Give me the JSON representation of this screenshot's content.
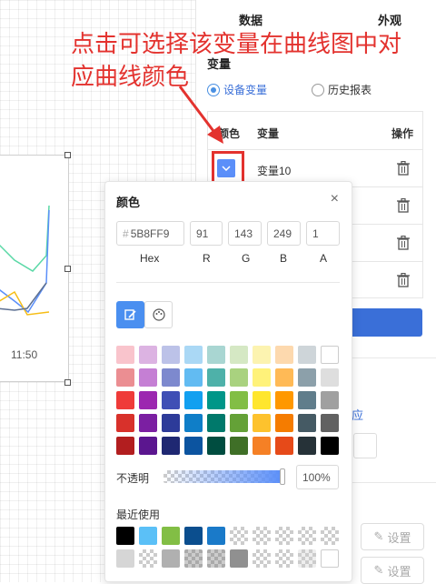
{
  "annotation": {
    "text": "点击可选择该变量在曲线图中对应曲线颜色",
    "color": "#e3322e"
  },
  "canvas": {
    "tick_label": "11:50"
  },
  "panel": {
    "tabs": [
      "数据",
      "外观"
    ],
    "section_title": "变量",
    "radio": {
      "options": [
        "设备变量",
        "历史报表"
      ],
      "selected": "设备变量"
    },
    "table": {
      "headers": {
        "color": "颜色",
        "variable": "变量",
        "action": "操作"
      },
      "rows": [
        {
          "name": "变量10",
          "color": "#5B8FF9"
        }
      ]
    },
    "link_partial": "应",
    "set_buttons": [
      "设置",
      "设置"
    ]
  },
  "picker": {
    "title": "颜色",
    "hex_value": "5B8FF9",
    "hex_prefix": "#",
    "r": "91",
    "g": "143",
    "b": "249",
    "a": "1",
    "labels": {
      "hex": "Hex",
      "r": "R",
      "g": "G",
      "b": "B",
      "a": "A"
    },
    "modes": [
      "palette-edit-icon",
      "palette-icon"
    ],
    "active_mode": "palette-edit-icon",
    "palette": [
      [
        "#f9c4cc",
        "#dcb3e2",
        "#bcc2e8",
        "#aad8f5",
        "#a9d6d2",
        "#d5e8c4",
        "#fcf3b0",
        "#fdd9ae",
        "#ced5d9",
        "#ffffff"
      ],
      [
        "#eb8e92",
        "#c57fd4",
        "#7d89ce",
        "#62bbf2",
        "#4eb1a9",
        "#a9d27f",
        "#fff27a",
        "#ffba56",
        "#8ca0aa",
        "#dedede"
      ],
      [
        "#ef3b39",
        "#9c27b0",
        "#3f4fb5",
        "#12a0f0",
        "#009688",
        "#82be45",
        "#ffe62e",
        "#ff9800",
        "#607d8b",
        "#a0a0a0"
      ],
      [
        "#d8312b",
        "#7b1fa2",
        "#2d3b99",
        "#0f7ec8",
        "#00796b",
        "#64a137",
        "#fdc22d",
        "#f57c00",
        "#455a64",
        "#616161"
      ],
      [
        "#b21e1f",
        "#5b168f",
        "#1f2872",
        "#0c54a0",
        "#004d40",
        "#3f6f27",
        "#f58025",
        "#e64a19",
        "#263238",
        "#000000"
      ]
    ],
    "opacity_label": "不透明",
    "opacity_value": "100%",
    "opacity_fraction": 1.0,
    "recent_label": "最近使用",
    "recent": [
      [
        "#000000",
        "#5bc0f7",
        "#82be45",
        "#0b4e8e",
        "#1a7ac9",
        "checker",
        "checker",
        "checker",
        "checker",
        "checker"
      ],
      [
        "#d6d6d6",
        "checker",
        "#b0b0b0",
        "checker-dark",
        "checker-dark",
        "#909090",
        "checker",
        "checker",
        "checker-light",
        "#ffffff"
      ]
    ]
  }
}
